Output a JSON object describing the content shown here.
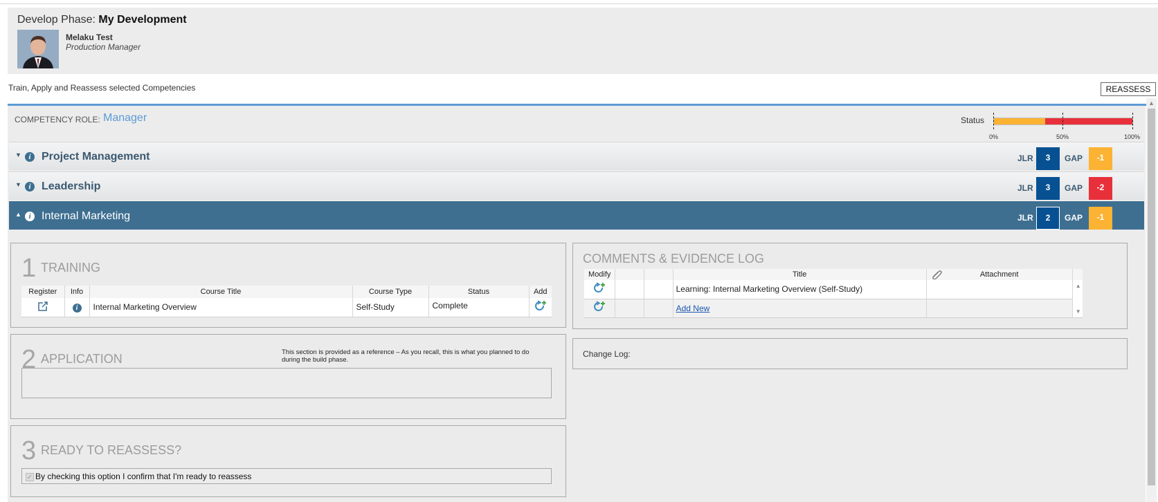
{
  "header": {
    "phase_label": "Develop Phase:",
    "phase_name": "My Development",
    "user_name": "Melaku Test",
    "user_role": "Production Manager"
  },
  "subtitle": "Train, Apply and Reassess selected Competencies",
  "reassess_button": "REASSESS",
  "competency_role": {
    "label": "COMPETENCY ROLE:",
    "value": "Manager"
  },
  "status": {
    "label": "Status",
    "progress_fraction": 0.37,
    "ticks": [
      "0%",
      "50%",
      "100%"
    ],
    "colors": {
      "done": "#fcb333",
      "remaining": "#e8303b"
    }
  },
  "competencies": [
    {
      "name": "Project Management",
      "expanded": false,
      "jlr_label": "JLR",
      "jlr": "3",
      "gap_label": "GAP",
      "gap": "-1",
      "gap_color": "#fcb333"
    },
    {
      "name": "Leadership",
      "expanded": false,
      "jlr_label": "JLR",
      "jlr": "3",
      "gap_label": "GAP",
      "gap": "-2",
      "gap_color": "#e8303b"
    },
    {
      "name": "Internal Marketing",
      "expanded": true,
      "jlr_label": "JLR",
      "jlr": "2",
      "gap_label": "GAP",
      "gap": "-1",
      "gap_color": "#fcb333"
    }
  ],
  "training": {
    "number": "1",
    "title": "TRAINING",
    "columns": [
      "Register",
      "Info",
      "Course Title",
      "Course Type",
      "Status",
      "Add"
    ],
    "rows": [
      {
        "course_title": "Internal Marketing Overview",
        "course_type": "Self-Study",
        "status": "Complete"
      }
    ]
  },
  "application": {
    "number": "2",
    "title": "APPLICATION",
    "note": "This section is provided as a reference – As you recall, this is what you planned to do during the build phase."
  },
  "ready": {
    "number": "3",
    "title": "READY TO REASSESS?",
    "checkbox_label": "By checking this option I confirm that I'm ready to reassess"
  },
  "evidence": {
    "title": "COMMENTS & EVIDENCE LOG",
    "columns": [
      "Modify",
      "",
      "Title",
      "Attachment"
    ],
    "rows": [
      {
        "title": "Learning: Internal Marketing Overview (Self-Study)"
      }
    ],
    "add_new": "Add New"
  },
  "change_log": {
    "label": "Change Log:"
  },
  "icons": [
    "info-icon",
    "external-link-icon",
    "add-refresh-icon",
    "paperclip-icon",
    "caret-down-icon",
    "caret-up-icon"
  ]
}
